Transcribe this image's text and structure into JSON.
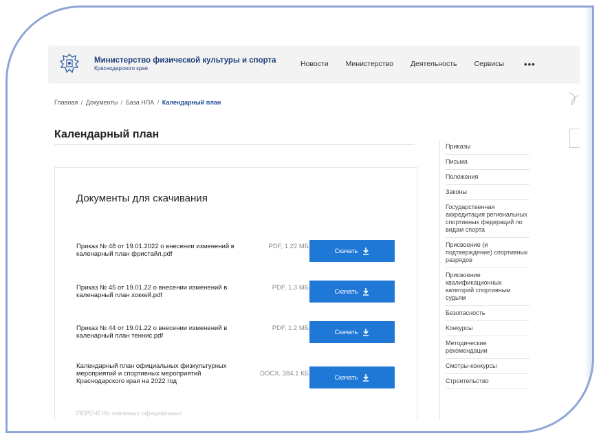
{
  "header": {
    "org_title": "Министерство физической культуры и спорта",
    "org_subtitle": "Краснодарского края",
    "nav": [
      "Новости",
      "Министерство",
      "Деятельность",
      "Сервисы"
    ],
    "more": "•••"
  },
  "breadcrumb": {
    "items": [
      "Главная",
      "Документы",
      "База НПА"
    ],
    "current": "Календарный план",
    "separator": "/"
  },
  "page_title": "Календарный план",
  "documents": {
    "heading": "Документы для скачивания",
    "download_label": "Скачать",
    "items": [
      {
        "name": "Приказ № 48 от 19.01.2022 о внесении изменений в каленарный план фристайл.pdf",
        "meta": "PDF, 1.22 МБ"
      },
      {
        "name": "Приказ № 45 от 19.01.22 о внесении изменений в каленарный план хоккей.pdf",
        "meta": "PDF, 1.3 МБ"
      },
      {
        "name": "Приказ № 44 от 19.01.22 о внесении изменений в каленарный план теннис.pdf",
        "meta": "PDF, 1.2 МБ"
      },
      {
        "name": "Календарный план официальных физкультурных мероприятий и спортивных мероприятий Краснодарского края на 2022 год",
        "meta": "DOCX, 384.1 КБ"
      }
    ],
    "faded_item": "ПЕРЕЧЕНЬ значимых официальных"
  },
  "sidebar": {
    "items": [
      "Приказы",
      "Письма",
      "Положения",
      "Законы",
      "Государственная аккредитация региональных спортивных федераций по видам спорта",
      "Присвоение (и подтверждение) спортивных разрядов",
      "Присвоение квалификационных категорий спортивным судьям",
      "Безопасность",
      "Конкурсы",
      "Методические рекомендации",
      "Смотры-конкурсы",
      "Строительство"
    ]
  },
  "colors": {
    "accent": "#1f77d6",
    "brand": "#1d3f7a",
    "frame": "#8ea6d6"
  }
}
